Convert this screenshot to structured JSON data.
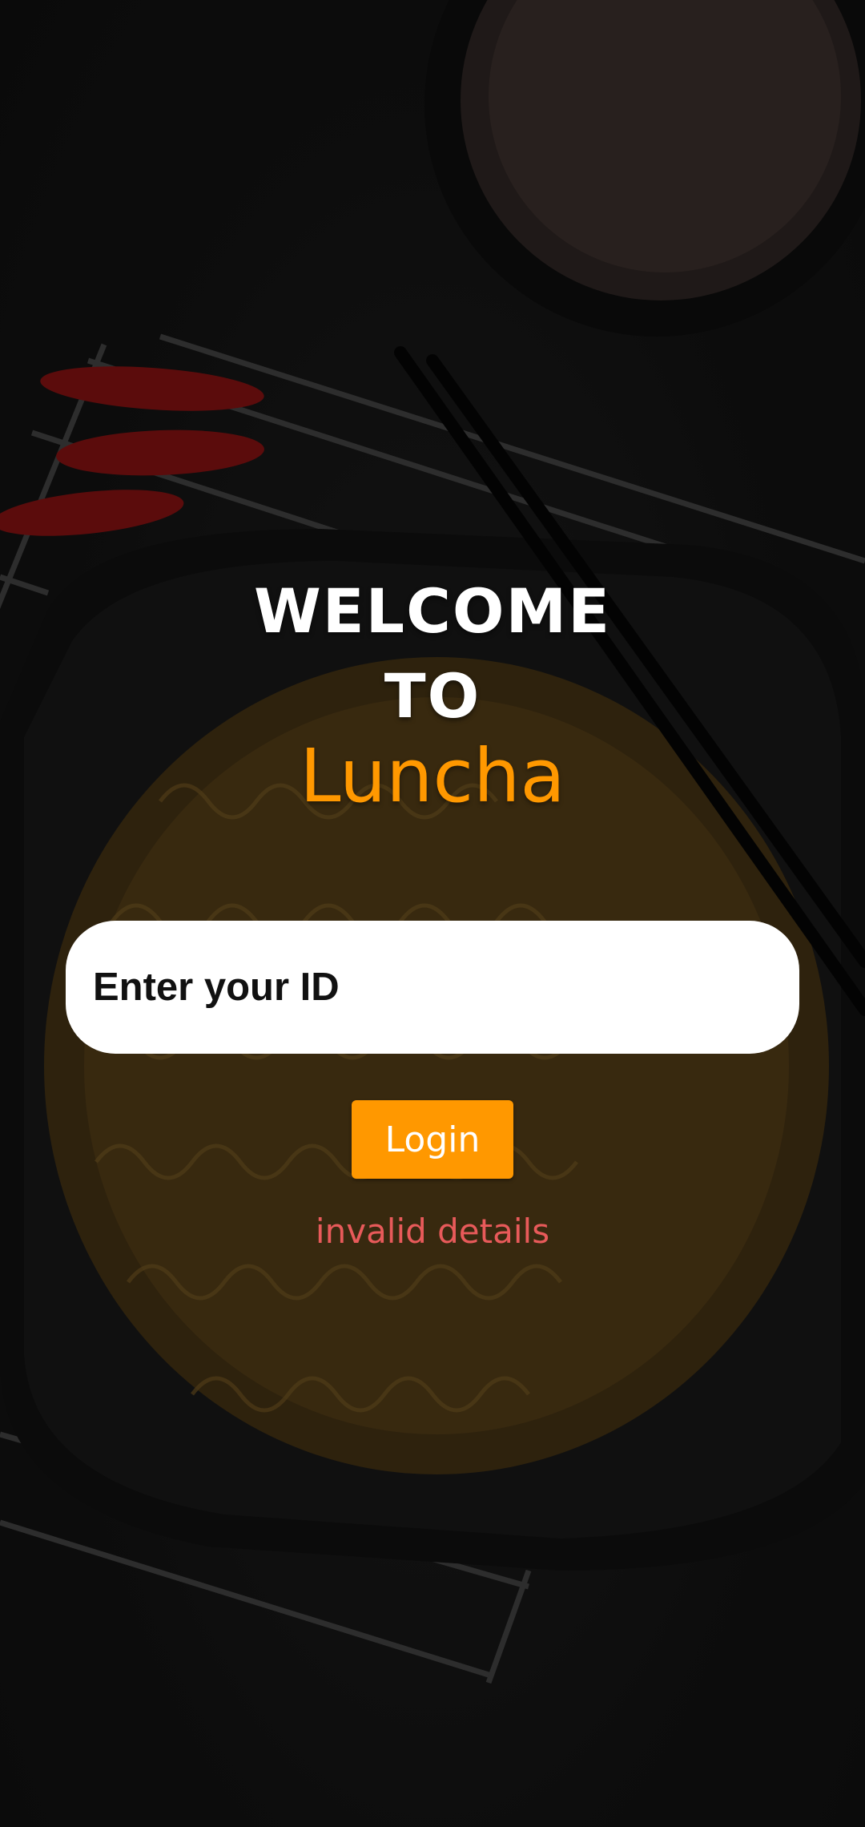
{
  "welcome": {
    "line1": "WELCOME",
    "line2": "TO",
    "brand": "Luncha"
  },
  "id_field": {
    "placeholder": "Enter your ID"
  },
  "login_button": {
    "label": "Login"
  },
  "error": {
    "message": "invalid details"
  },
  "colors": {
    "accent": "#ff9800",
    "error": "#e85a5a",
    "field_bg": "#ffffff",
    "background": "#141414"
  },
  "background_image": "noodle-plate-photo"
}
